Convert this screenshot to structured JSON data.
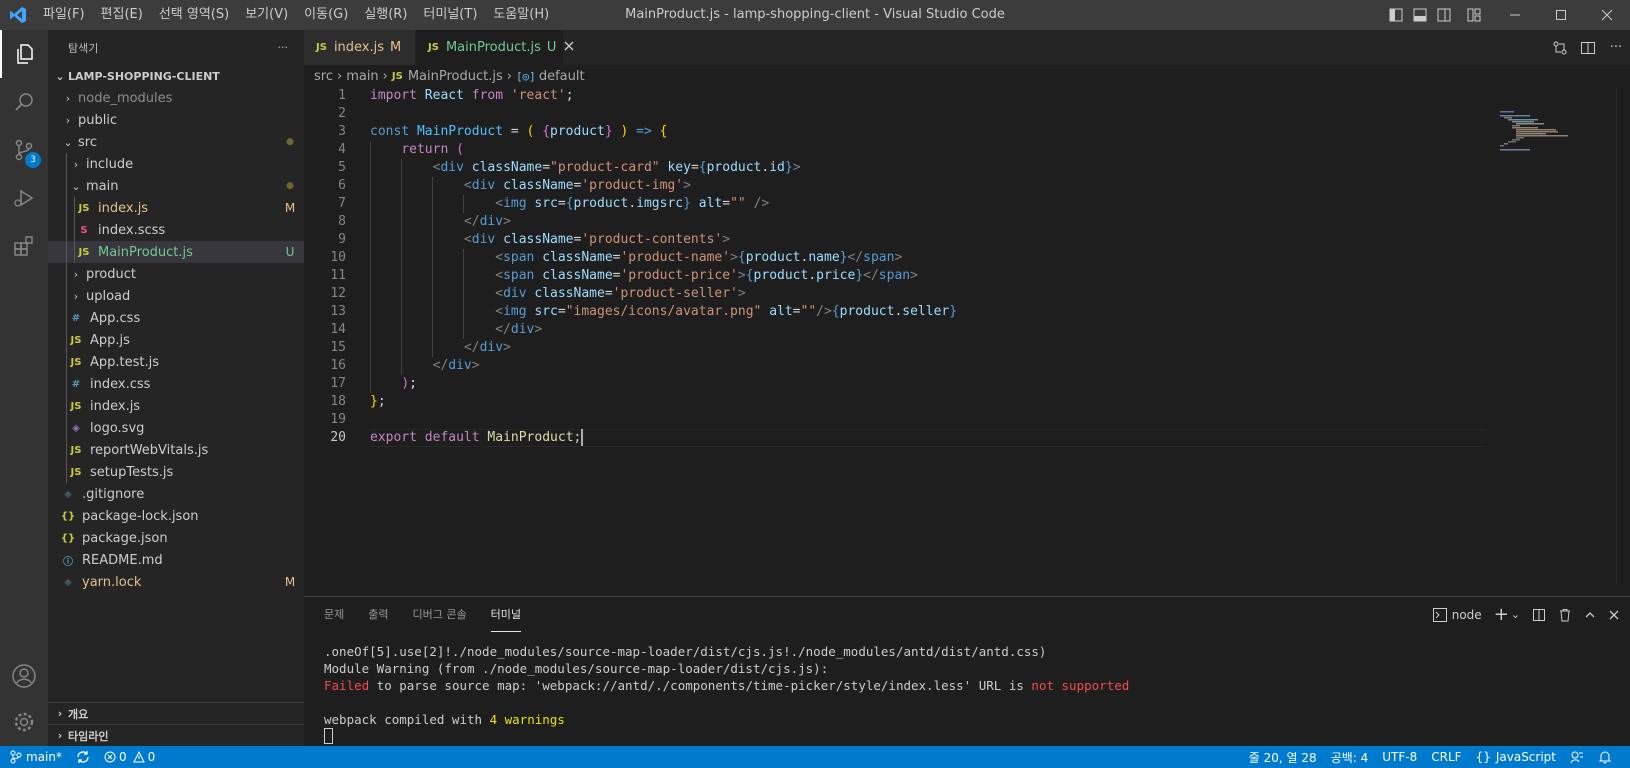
{
  "window": {
    "title": "MainProduct.js - lamp-shopping-client - Visual Studio Code",
    "menu": [
      "파일(F)",
      "편집(E)",
      "선택 영역(S)",
      "보기(V)",
      "이동(G)",
      "실행(R)",
      "터미널(T)",
      "도움말(H)"
    ]
  },
  "activity": {
    "scm_badge": "3"
  },
  "sidebar": {
    "header": "탐색기",
    "more": "···",
    "project": "LAMP-SHOPPING-CLIENT",
    "tree": [
      {
        "label": "node_modules",
        "icon": "",
        "chev": "›",
        "depth": 1,
        "color": "#8c8c8c",
        "dec": ""
      },
      {
        "label": "public",
        "icon": "",
        "chev": "›",
        "depth": 1,
        "color": "#cccccc",
        "dec": ""
      },
      {
        "label": "src",
        "icon": "",
        "chev": "⌄",
        "depth": 1,
        "color": "#cccccc",
        "dec": "●"
      },
      {
        "label": "include",
        "icon": "",
        "chev": "›",
        "depth": 2,
        "color": "#cccccc",
        "dec": ""
      },
      {
        "label": "main",
        "icon": "",
        "chev": "⌄",
        "depth": 2,
        "color": "#cccccc",
        "dec": "●"
      },
      {
        "label": "index.js",
        "icon": "JS",
        "chev": "",
        "depth": 3,
        "color": "#e2c08d",
        "dec": "M"
      },
      {
        "label": "index.scss",
        "icon": "S",
        "chev": "",
        "depth": 3,
        "color": "#cccccc",
        "dec": ""
      },
      {
        "label": "MainProduct.js",
        "icon": "JS",
        "chev": "",
        "depth": 3,
        "color": "#73c991",
        "dec": "U"
      },
      {
        "label": "product",
        "icon": "",
        "chev": "›",
        "depth": 2,
        "color": "#cccccc",
        "dec": ""
      },
      {
        "label": "upload",
        "icon": "",
        "chev": "›",
        "depth": 2,
        "color": "#cccccc",
        "dec": ""
      },
      {
        "label": "App.css",
        "icon": "#",
        "chev": "",
        "depth": 2,
        "color": "#cccccc",
        "dec": ""
      },
      {
        "label": "App.js",
        "icon": "JS",
        "chev": "",
        "depth": 2,
        "color": "#cccccc",
        "dec": ""
      },
      {
        "label": "App.test.js",
        "icon": "JS",
        "chev": "",
        "depth": 2,
        "color": "#cccccc",
        "dec": ""
      },
      {
        "label": "index.css",
        "icon": "#",
        "chev": "",
        "depth": 2,
        "color": "#cccccc",
        "dec": ""
      },
      {
        "label": "index.js",
        "icon": "JS",
        "chev": "",
        "depth": 2,
        "color": "#cccccc",
        "dec": ""
      },
      {
        "label": "logo.svg",
        "icon": "◈",
        "chev": "",
        "depth": 2,
        "color": "#cccccc",
        "dec": ""
      },
      {
        "label": "reportWebVitals.js",
        "icon": "JS",
        "chev": "",
        "depth": 2,
        "color": "#cccccc",
        "dec": ""
      },
      {
        "label": "setupTests.js",
        "icon": "JS",
        "chev": "",
        "depth": 2,
        "color": "#cccccc",
        "dec": ""
      },
      {
        "label": ".gitignore",
        "icon": "◆",
        "chev": "",
        "depth": 1,
        "color": "#cccccc",
        "dec": ""
      },
      {
        "label": "package-lock.json",
        "icon": "{}",
        "chev": "",
        "depth": 1,
        "color": "#cccccc",
        "dec": ""
      },
      {
        "label": "package.json",
        "icon": "{}",
        "chev": "",
        "depth": 1,
        "color": "#cccccc",
        "dec": ""
      },
      {
        "label": "README.md",
        "icon": "ⓘ",
        "chev": "",
        "depth": 1,
        "color": "#cccccc",
        "dec": ""
      },
      {
        "label": "yarn.lock",
        "icon": "◆",
        "chev": "",
        "depth": 1,
        "color": "#e2c08d",
        "dec": "M"
      }
    ],
    "outline": "개요",
    "timeline": "타임라인"
  },
  "tabs": [
    {
      "label": "index.js",
      "status": "M",
      "active": false
    },
    {
      "label": "MainProduct.js",
      "status": "U",
      "active": true
    }
  ],
  "breadcrumb": [
    "src",
    "main",
    "MainProduct.js",
    "default"
  ],
  "editor": {
    "line_numbers": [
      "1",
      "2",
      "3",
      "4",
      "5",
      "6",
      "7",
      "8",
      "9",
      "10",
      "11",
      "12",
      "13",
      "14",
      "15",
      "16",
      "17",
      "18",
      "19",
      "20"
    ],
    "current_line": "20"
  },
  "panel": {
    "tabs": [
      "문제",
      "출력",
      "디버그 콘솔",
      "터미널"
    ],
    "active_tab": "터미널",
    "shell": "node",
    "terminal": {
      "line1": ".oneOf[5].use[2]!./node_modules/source-map-loader/dist/cjs.js!./node_modules/antd/dist/antd.css)",
      "line2": "Module Warning (from ./node_modules/source-map-loader/dist/cjs.js):",
      "line3_a": "Failed",
      "line3_b": " to parse source map: 'webpack://antd/./components/time-picker/style/index.less' URL is ",
      "line3_c": "not supported",
      "line5_a": "webpack compiled with ",
      "line5_b": "4 warnings"
    }
  },
  "status": {
    "branch": "main*",
    "errors": "0",
    "warnings": "0",
    "position": "줄 20, 열 28",
    "spaces": "공백: 4",
    "encoding": "UTF-8",
    "eol": "CRLF",
    "language": "JavaScript"
  }
}
